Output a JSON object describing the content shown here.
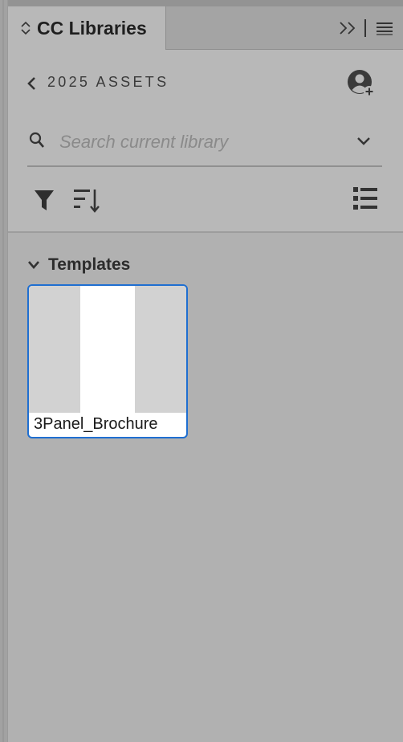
{
  "panel": {
    "tab_title": "CC Libraries"
  },
  "header": {
    "library_name": "2025 ASSETS"
  },
  "search": {
    "placeholder": "Search current library"
  },
  "content": {
    "section_label": "Templates",
    "assets": [
      {
        "name": "3Panel_Brochure"
      }
    ]
  },
  "colors": {
    "selection_border": "#1f6fd1",
    "panel_bg": "#b1b1b1",
    "header_bg": "#b8b8b8"
  },
  "icons": [
    "tab-reorder-icon",
    "expand-panel-icon",
    "panel-menu-icon",
    "back-chevron-icon",
    "add-user-icon",
    "search-icon",
    "chevron-down-icon",
    "filter-icon",
    "sort-icon",
    "list-view-icon",
    "collapse-chevron-icon"
  ]
}
